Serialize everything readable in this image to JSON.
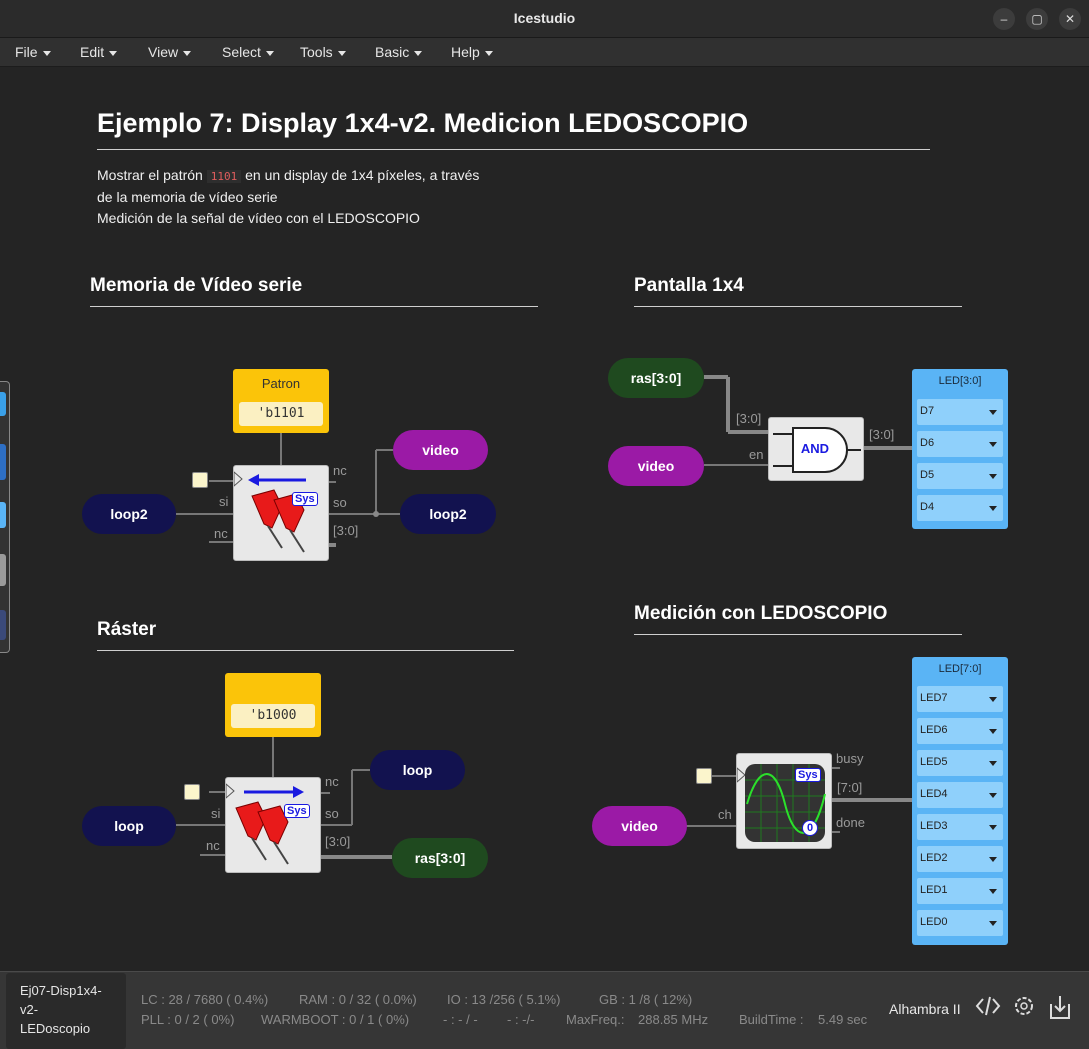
{
  "window": {
    "title": "Icestudio"
  },
  "menu": [
    "File",
    "Edit",
    "View",
    "Select",
    "Tools",
    "Basic",
    "Help"
  ],
  "doc": {
    "title": "Ejemplo 7: Display 1x4-v2. Medicion LEDOSCOPIO",
    "desc_part1": "Mostrar el patrón",
    "desc_code": "1101",
    "desc_part2": "en un display de 1x4 píxeles, a través",
    "desc_line2": "de la memoria de vídeo serie",
    "desc_line3": "Medición de la señal de vídeo con el LEDOSCOPIO"
  },
  "sections": {
    "memoria": "Memoria de Vídeo serie",
    "pantalla": "Pantalla 1x4",
    "raster": "Ráster",
    "medicion": "Medición con LEDOSCOPIO"
  },
  "memoria": {
    "const_label": "Patron",
    "const_value": "'b1101",
    "in_label": "loop2",
    "out_video": "video",
    "out_loop": "loop2",
    "port_si": "si",
    "port_nc_left": "nc",
    "port_nc_top": "nc",
    "port_so": "so",
    "port_bus": "[3:0]",
    "sys": "Sys"
  },
  "pantalla": {
    "in_ras": "ras[3:0]",
    "in_video": "video",
    "gate": "AND",
    "bus_in": "[3:0]",
    "bus_out": "[3:0]",
    "port_en": "en",
    "led_title": "LED[3:0]",
    "leds": [
      "D7",
      "D6",
      "D5",
      "D4"
    ]
  },
  "raster": {
    "const_value": "'b1000",
    "in_label": "loop",
    "out_loop": "loop",
    "out_ras": "ras[3:0]",
    "port_si": "si",
    "port_nc_left": "nc",
    "port_nc_top": "nc",
    "port_so": "so",
    "port_bus": "[3:0]",
    "sys": "Sys"
  },
  "medicion": {
    "in_video": "video",
    "port_ch": "ch",
    "port_busy": "busy",
    "port_bus": "[7:0]",
    "port_done": "done",
    "sys": "Sys",
    "zero": "0",
    "led_title": "LED[7:0]",
    "leds": [
      "LED7",
      "LED6",
      "LED5",
      "LED4",
      "LED3",
      "LED2",
      "LED1",
      "LED0"
    ]
  },
  "status": {
    "file_line1": "Ej07-Disp1x4-",
    "file_line2": "v2-",
    "file_line3": "LEDoscopio",
    "lc": "LC : 28 / 7680 ( 0.4%)",
    "ram": "RAM : 0 / 32 ( 0.0%)",
    "io": "IO : 13 /256 ( 5.1%)",
    "gb": "GB : 1 /8 ( 12%)",
    "pll": "PLL : 0 / 2 ( 0%)",
    "warmboot": "WARMBOOT : 0 / 1 ( 0%)",
    "dash1": "- : - / -",
    "dash2": "- : -/-",
    "maxfreq_label": "MaxFreq.:",
    "maxfreq": "288.85 MHz",
    "buildtime_label": "BuildTime :",
    "buildtime": "5.49 sec",
    "board": "Alhambra II"
  }
}
